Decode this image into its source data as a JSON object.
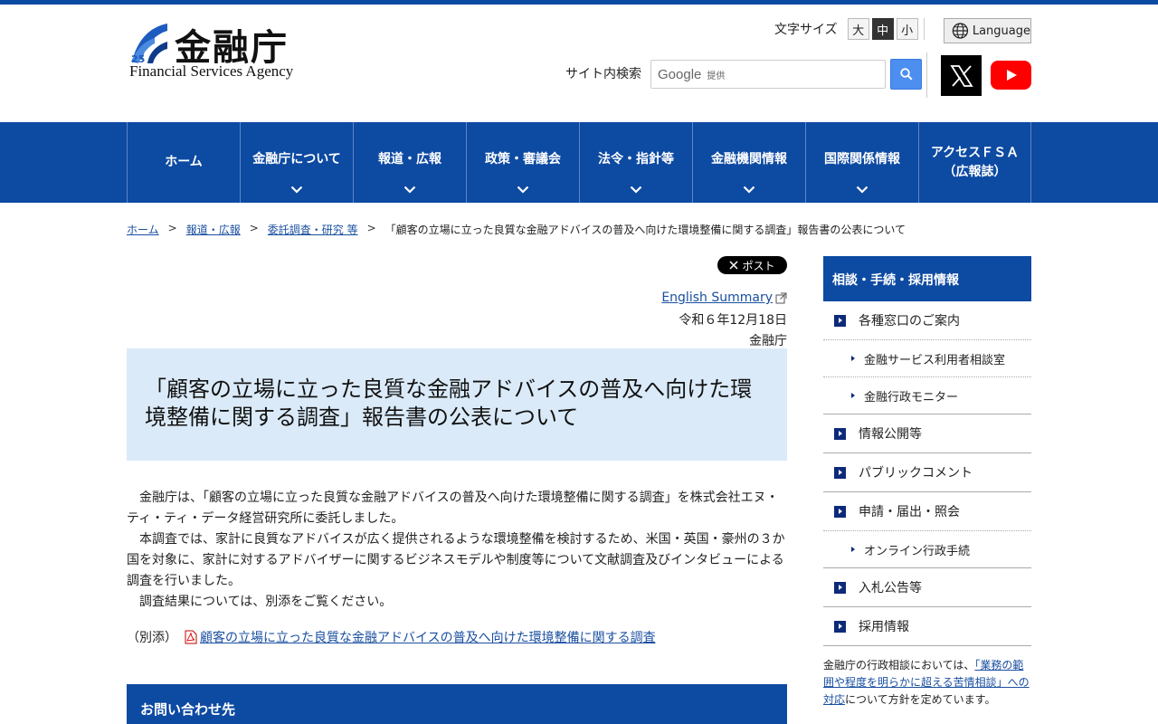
{
  "header": {
    "logo_kanji": "金融庁",
    "logo_en": "Financial Services Agency",
    "fontsize_label": "文字サイズ",
    "fontsize_options": [
      "大",
      "中",
      "小"
    ],
    "language_label": "Language",
    "search_label": "サイト内検索",
    "search_google": "Google",
    "search_provided": "提供"
  },
  "nav": {
    "items": [
      "ホーム",
      "金融庁について",
      "報道・広報",
      "政策・審議会",
      "法令・指針等",
      "金融機関情報",
      "国際関係情報",
      "アクセスＦＳＡ\n（広報誌）"
    ]
  },
  "breadcrumb": [
    "ホーム",
    "報道・広報",
    "委託調査・研究 等",
    "「顧客の立場に立った良質な金融アドバイスの普及へ向けた環境整備に関する調査」報告書の公表について"
  ],
  "breadcrumb_sep": ">",
  "main": {
    "post_label": "ポスト",
    "english_summary": "English Summary",
    "date": "令和６年12月18日",
    "org": "金融庁",
    "title": "「顧客の立場に立った良質な金融アドバイスの普及へ向けた環境整備に関する調査」報告書の公表について",
    "paragraphs": [
      "金融庁は、「顧客の立場に立った良質な金融アドバイスの普及へ向けた環境整備に関する調査」を株式会社エヌ・ティ・ティ・データ経営研究所に委託しました。",
      "本調査では、家計に良質なアドバイスが広く提供されるような環境整備を検討するため、米国・英国・豪州の３か国を対象に、家計に対するアドバイザーに関するビジネスモデルや制度等について文献調査及びインタビューによる調査を行いました。",
      "調査結果については、別添をご覧ください。"
    ],
    "attachment_label": "（別添）",
    "attachment_link": "顧客の立場に立った良質な金融アドバイスの普及へ向けた環境整備に関する調査",
    "contact_heading": "お問い合わせ先"
  },
  "sidebar": {
    "heading": "相談・手続・採用情報",
    "item_1": "各種窓口のご案内",
    "sub_1a": "金融サービス利用者相談室",
    "sub_1b": "金融行政モニター",
    "item_2": "情報公開等",
    "item_3": "パブリックコメント",
    "item_4": "申請・届出・照会",
    "sub_4a": "オンライン行政手続",
    "item_5": "入札公告等",
    "item_6": "採用情報",
    "note_before": "金融庁の行政相談においては、",
    "note_link": "「業務の範囲や程度を明らかに超える苦情相談」への対応",
    "note_after": "について方針を定めています。"
  },
  "colors": {
    "brand_blue": "#0d4aa2",
    "title_bg": "#daeaf8"
  }
}
